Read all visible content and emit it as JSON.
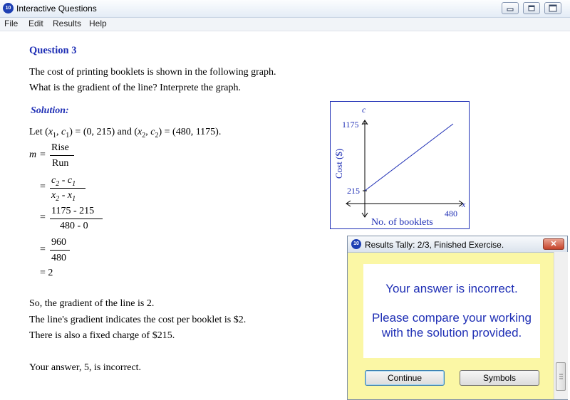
{
  "window": {
    "title": "Interactive Questions",
    "icon_text": "10"
  },
  "menu": [
    "File",
    "Edit",
    "Results",
    "Help"
  ],
  "question": {
    "title": "Question 3",
    "line1": "The cost of printing booklets is shown in the following graph.",
    "line2": "What is the gradient of the line?  Interprete the graph."
  },
  "solution": {
    "heading": "Solution",
    "let_prefix": "Let (",
    "let_text": "(x1, c1) = (0, 215) and (x2, c2) = (480, 1175).",
    "m": "m",
    "eq": "=",
    "rise": "Rise",
    "run": "Run",
    "num_sym": "c2 - c1",
    "den_sym": "x2 - x1",
    "num_val": "1175 - 215",
    "den_val": "480 - 0",
    "num_simpl": "960",
    "den_simpl": "480",
    "result": "= 2",
    "conclusion1": "So, the gradient of the line is 2.",
    "conclusion2": "The line's gradient indicates the cost per booklet is $2.",
    "conclusion3": "There is also a fixed charge of $215.",
    "feedback": "Your answer, 5, is incorrect."
  },
  "graph": {
    "y_axis_var": "c",
    "x_axis_var": "x",
    "y_axis_label": "Cost ($)",
    "x_axis_label": "No. of booklets",
    "y_tick_high": "1175",
    "y_tick_low": "215",
    "x_tick": "480",
    "line_color": "#1f2fb5"
  },
  "dialog": {
    "title": "Results Tally:  2/3, Finished Exercise.",
    "close_label": "✕",
    "message1": "Your answer is incorrect.",
    "message2": "Please compare your working",
    "message3": "with the solution provided.",
    "continue_label": "Continue",
    "symbols_label": "Symbols"
  }
}
